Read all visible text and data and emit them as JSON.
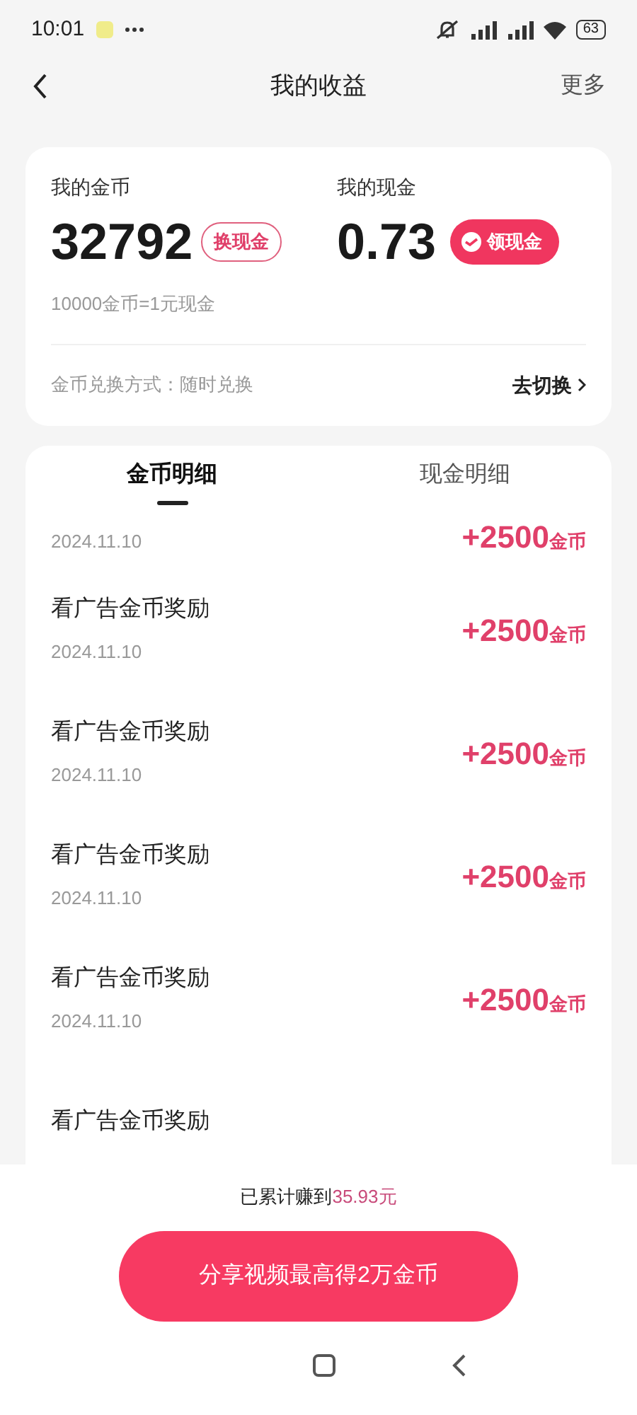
{
  "status_bar": {
    "time": "10:01",
    "battery": "63"
  },
  "header": {
    "title": "我的收益",
    "more": "更多"
  },
  "summary": {
    "coins_label": "我的金币",
    "coins": "32792",
    "exchange_button": "换现金",
    "cash_label": "我的现金",
    "cash": "0.73",
    "withdraw_button": "领现金",
    "rate": "10000金币=1元现金",
    "method": "金币兑换方式：随时兑换",
    "switch_link": "去切换"
  },
  "tabs": [
    {
      "label": "金币明细",
      "selected": true
    },
    {
      "label": "现金明细",
      "selected": false
    }
  ],
  "records": [
    {
      "date": "2024.11.10",
      "amount": "+2500",
      "unit": "金币"
    },
    {
      "title": "看广告金币奖励",
      "date": "2024.11.10",
      "amount": "+2500",
      "unit": "金币"
    },
    {
      "title": "看广告金币奖励",
      "date": "2024.11.10",
      "amount": "+2500",
      "unit": "金币"
    },
    {
      "title": "看广告金币奖励",
      "date": "2024.11.10",
      "amount": "+2500",
      "unit": "金币"
    },
    {
      "title": "看广告金币奖励",
      "date": "2024.11.10",
      "amount": "+2500",
      "unit": "金币"
    },
    {
      "title": "看广告金币奖励"
    }
  ],
  "footer": {
    "total_prefix": "已累计赚到",
    "total_value": "35.93元",
    "share_button": "分享视频最高得2万金币"
  }
}
